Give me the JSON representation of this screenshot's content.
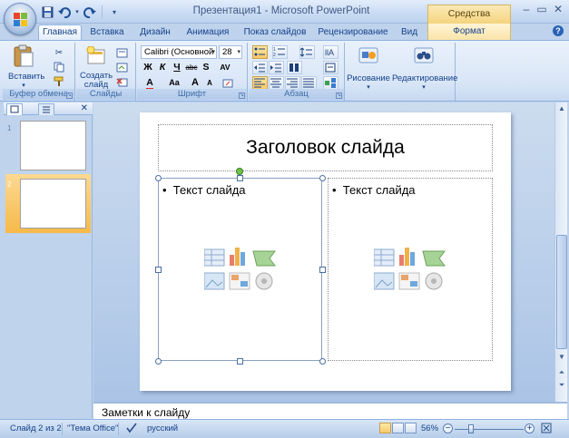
{
  "title_bar": {
    "window_title": "Презентация1 - Microsoft PowerPoint",
    "contextual_tool": "Средства рисования",
    "controls": [
      "minimize-icon",
      "maximize-icon",
      "close-icon"
    ]
  },
  "quick_access": [
    "save-icon",
    "undo-icon",
    "redo-icon",
    "customize-icon"
  ],
  "tabs": [
    {
      "label": "Главная",
      "active": true
    },
    {
      "label": "Вставка"
    },
    {
      "label": "Дизайн"
    },
    {
      "label": "Анимация"
    },
    {
      "label": "Показ слайдов"
    },
    {
      "label": "Рецензирование"
    },
    {
      "label": "Вид"
    },
    {
      "label": "Формат",
      "contextual": true
    }
  ],
  "ribbon": {
    "clipboard": {
      "label": "Буфер обмена",
      "paste": "Вставить"
    },
    "slides": {
      "label": "Слайды",
      "create_line1": "Создать",
      "create_line2": "слайд"
    },
    "font": {
      "label": "Шрифт",
      "font_name": "Calibri (Основной",
      "font_size": "28",
      "bold": "Ж",
      "italic": "К",
      "underline": "Ч",
      "strike": "abc",
      "shadow": "S",
      "spacing": "AV",
      "case": "Aa",
      "grow": "A",
      "shrink": "A"
    },
    "paragraph": {
      "label": "Абзац"
    },
    "drawing": {
      "label": "Рисование"
    },
    "editing": {
      "label": "Редактирование"
    }
  },
  "slide_pane": {
    "slides": [
      {
        "number": "1"
      },
      {
        "number": "2",
        "selected": true
      }
    ]
  },
  "slide": {
    "title": "Заголовок слайда",
    "left_text": "Текст слайда",
    "right_text": "Текст слайда",
    "bullet": "•"
  },
  "notes": {
    "placeholder": "Заметки к слайду"
  },
  "status_bar": {
    "slide_info": "Слайд 2 из 2",
    "theme": "\"Тема Office\"",
    "language": "русский",
    "zoom": "56%",
    "zoom_minus": "−",
    "zoom_plus": "+"
  },
  "colors": {
    "ribbon_bg": "#d9e6f7",
    "accent": "#15428b",
    "selection": "#f4a93c"
  }
}
